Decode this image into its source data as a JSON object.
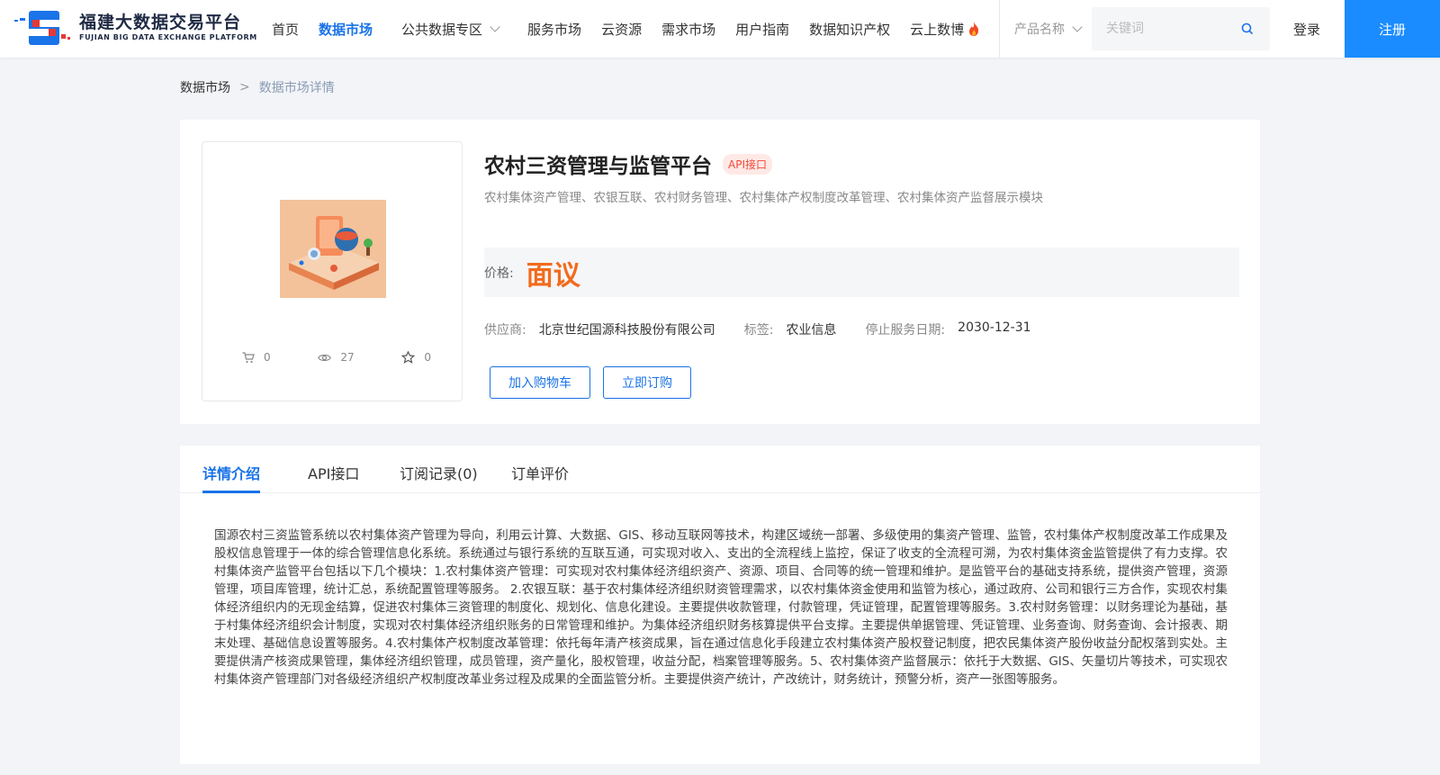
{
  "header": {
    "logo_cn": "福建大数据交易平台",
    "logo_en": "FUJIAN BIG DATA EXCHANGE  PLATFORM",
    "nav": [
      "首页",
      "数据市场",
      "公共数据专区",
      "服务市场",
      "云资源",
      "需求市场",
      "用户指南",
      "数据知识产权",
      "云上数博"
    ],
    "active_nav": "数据市场",
    "search_category": "产品名称",
    "search_placeholder": "关键词",
    "login": "登录",
    "register": "注册",
    "brand_color": "#1a8cff"
  },
  "breadcrumb": [
    "数据市场",
    ">",
    "数据市场详情"
  ],
  "product": {
    "title": "农村三资管理与监管平台",
    "badge": "API接口",
    "description": "农村集体资产管理、农银互联、农村财务管理、农村集体产权制度改革管理、农村集体资产监督展示模块",
    "price_label": "价格:",
    "price": "面议",
    "supplier_label": "供应商:",
    "supplier": "北京世纪国源科技股份有限公司",
    "tag_label": "标签:",
    "tag": "农业信息",
    "end_date_label": "停止服务日期:",
    "end_date": "2030-12-31",
    "stats": {
      "cart": "0",
      "views": "27",
      "favorites": "0"
    },
    "add_to_cart": "加入购物车",
    "subscribe": "立即订购"
  },
  "tabs": [
    "详情介绍",
    "API接口",
    "订阅记录(0)",
    "订单评价"
  ],
  "detail_text": "国源农村三资监管系统以农村集体资产管理为导向，利用云计算、大数据、GIS、移动互联网等技术，构建区域统一部署、多级使用的集资产管理、监管，农村集体产权制度改革工作成果及股权信息管理于一体的综合管理信息化系统。系统通过与银行系统的互联互通，可实现对收入、支出的全流程线上监控，保证了收支的全流程可溯，为农村集体资金监管提供了有力支撑。农村集体资产监管平台包括以下几个模块：1.农村集体资产管理：可实现对农村集体经济组织资产、资源、项目、合同等的统一管理和维护。是监管平台的基础支持系统，提供资产管理，资源管理，项目库管理，统计汇总，系统配置管理等服务。 2.农银互联：基于农村集体经济组织财资管理需求，以农村集体资金使用和监管为核心，通过政府、公司和银行三方合作，实现农村集体经济组织内的无现金结算，促进农村集体三资管理的制度化、规划化、信息化建设。主要提供收款管理，付款管理，凭证管理，配置管理等服务。3.农村财务管理：以财务理论为基础，基于村集体经济组织会计制度，实现对农村集体经济组织账务的日常管理和维护。为集体经济组织财务核算提供平台支撑。主要提供单据管理、凭证管理、业务查询、财务查询、会计报表、期末处理、基础信息设置等服务。4.农村集体产权制度改革管理：依托每年清产核资成果，旨在通过信息化手段建立农村集体资产股权登记制度，把农民集体资产股份收益分配权落到实处。主要提供清产核资成果管理，集体经济组织管理，成员管理，资产量化，股权管理，收益分配，档案管理等服务。5、农村集体资产监督展示：依托于大数据、GIS、矢量切片等技术，可实现农村集体资产管理部门对各级经济组织产权制度改革业务过程及成果的全面监管分析。主要提供资产统计，产改统计，财务统计，预警分析，资产一张图等服务。"
}
